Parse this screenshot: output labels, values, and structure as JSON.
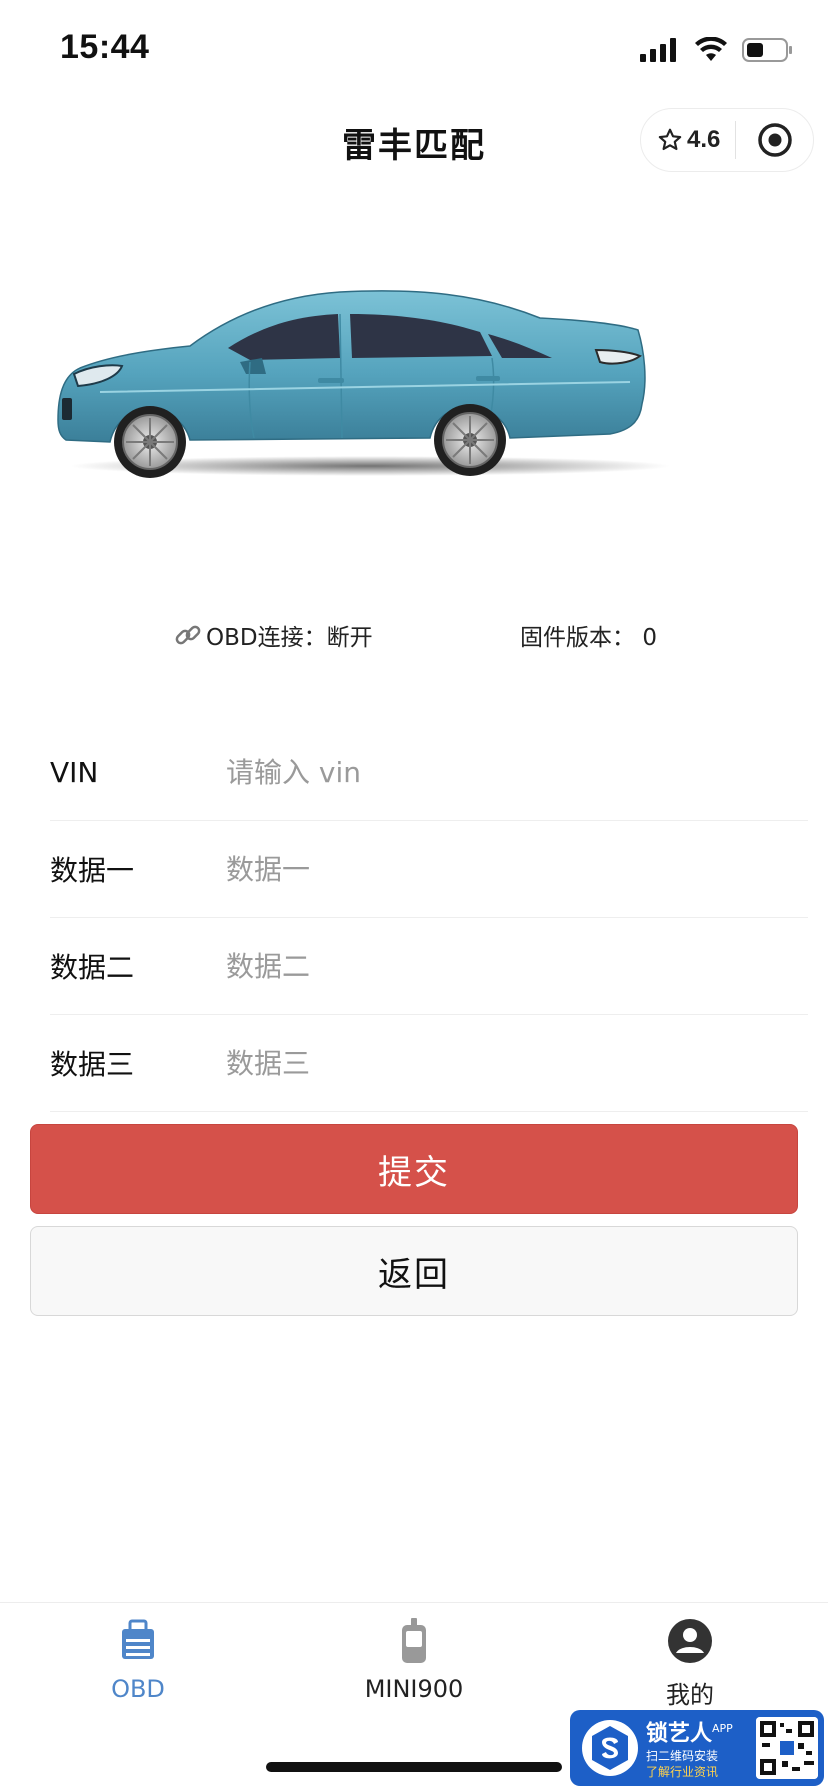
{
  "status_bar": {
    "time": "15:44"
  },
  "nav": {
    "title": "雷丰匹配",
    "rating": "4.6"
  },
  "info": {
    "obd_label": "OBD连接：",
    "obd_value": "断开",
    "firmware_label": "固件版本：",
    "firmware_value": "0"
  },
  "form": {
    "fields": [
      {
        "label": "VIN",
        "placeholder": "请输入 vin",
        "value": ""
      },
      {
        "label": "数据一",
        "placeholder": "数据一",
        "value": ""
      },
      {
        "label": "数据二",
        "placeholder": "数据二",
        "value": ""
      },
      {
        "label": "数据三",
        "placeholder": "数据三",
        "value": ""
      }
    ]
  },
  "buttons": {
    "submit": "提交",
    "back": "返回"
  },
  "tabbar": {
    "tabs": [
      {
        "label": "OBD",
        "icon": "obd-device-icon",
        "active": true
      },
      {
        "label": "MINI900",
        "icon": "handheld-device-icon",
        "active": false
      },
      {
        "label": "我的",
        "icon": "user-avatar-icon",
        "active": false
      }
    ]
  },
  "watermark": {
    "title": "锁艺人",
    "badge": "APP",
    "line1": "扫二维码安装",
    "line2": "了解行业资讯"
  },
  "colors": {
    "accent_red": "#d5514a",
    "tab_active": "#4f86c9",
    "car_body": "#5aa7c0"
  }
}
